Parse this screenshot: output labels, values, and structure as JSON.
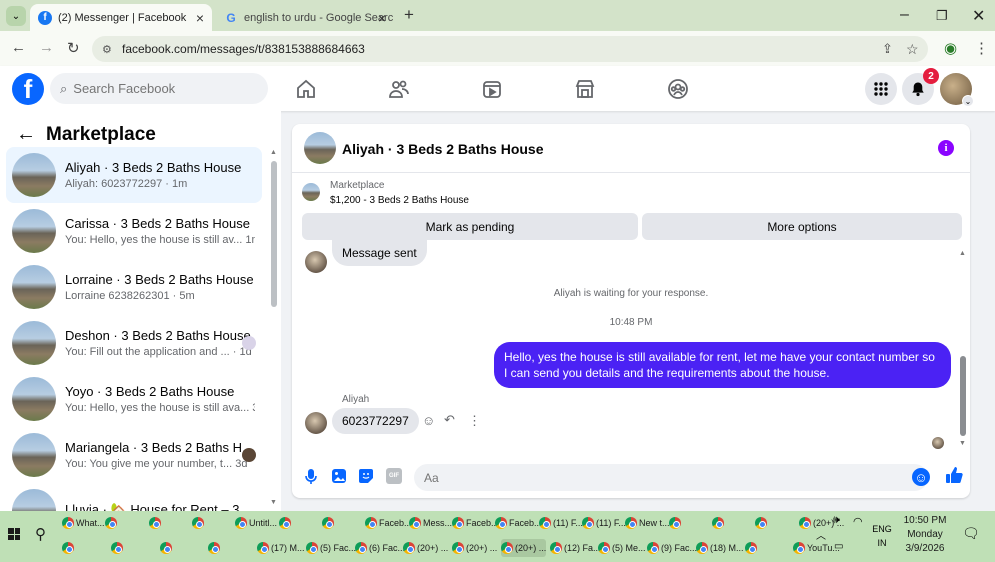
{
  "browser": {
    "tabs": [
      {
        "title": "(2) Messenger | Facebook",
        "active": true
      },
      {
        "title": "english to urdu - Google Searc",
        "active": false
      }
    ],
    "url": "facebook.com/messages/t/838153888684663"
  },
  "fb": {
    "logo": "f",
    "search_placeholder": "Search Facebook",
    "notifications_count": "2"
  },
  "sidebar": {
    "title": "Marketplace",
    "conversations": [
      {
        "name": "Aliyah · 3 Beds 2 Baths House",
        "snippet": "Aliyah: 6023772297 · 1m",
        "selected": true
      },
      {
        "name": "Carissa · 3 Beds 2 Baths House",
        "snippet": "You: Hello, yes the house is still av...  1m"
      },
      {
        "name": "Lorraine · 3 Beds 2 Baths House",
        "snippet": "Lorraine 6238262301 · 5m"
      },
      {
        "name": "Deshon · 3 Beds 2 Baths House",
        "snippet": "You: Fill out the application and ... · 1d"
      },
      {
        "name": "Yoyo · 3 Beds 2 Baths House",
        "snippet": "You: Hello, yes the house is still ava... 3d"
      },
      {
        "name": "Mariangela · 3 Beds 2 Baths H...",
        "snippet": "You: You give me your number, t...  3d"
      },
      {
        "name": "Lluvia · 🏡 House for Rent – 3 B...",
        "snippet": ""
      }
    ]
  },
  "chat": {
    "title": "Aliyah · 3 Beds 2 Baths House",
    "listing_label": "Marketplace",
    "listing_price": "$1,200 - 3 Beds 2 Baths House",
    "mark_pending": "Mark as pending",
    "more_options": "More options",
    "prev_message": "Message sent",
    "waiting_note": "Aliyah is waiting for your response.",
    "time": "10:48 PM",
    "outgoing": "Hello, yes the house is still available for rent, let me have your contact number so I can send you details and the requirements about the house.",
    "sender_name": "Aliyah",
    "incoming": "6023772297",
    "composer_placeholder": "Aa"
  },
  "taskbar": {
    "row1": [
      "What...",
      "",
      "",
      "",
      "Untitl...",
      "",
      "",
      "Faceb...",
      "Mess...",
      "Faceb...",
      "Faceb...",
      "(11) F...",
      "(11) F...",
      "New t...",
      "",
      "",
      "",
      "(20+) ..."
    ],
    "row2": [
      "",
      "",
      "",
      "",
      "(17) M...",
      "(5) Fac...",
      "(6) Fac...",
      "(20+) ...",
      "(20+) ...",
      "(20+) ...",
      "(12) Fa...",
      "(5) Me...",
      "(9) Fac...",
      "(18) M...",
      "",
      "YouTu..."
    ],
    "lang": "ENG",
    "lang2": "IN",
    "time": "10:50 PM",
    "day": "Monday",
    "date": "3/9/2026"
  },
  "colors": {
    "fb_blue": "#0866ff",
    "outgoing_bubble": "#4b22f4",
    "selected_row": "#ebf5ff",
    "badge": "#e41e3f",
    "info": "#8a04ff"
  }
}
